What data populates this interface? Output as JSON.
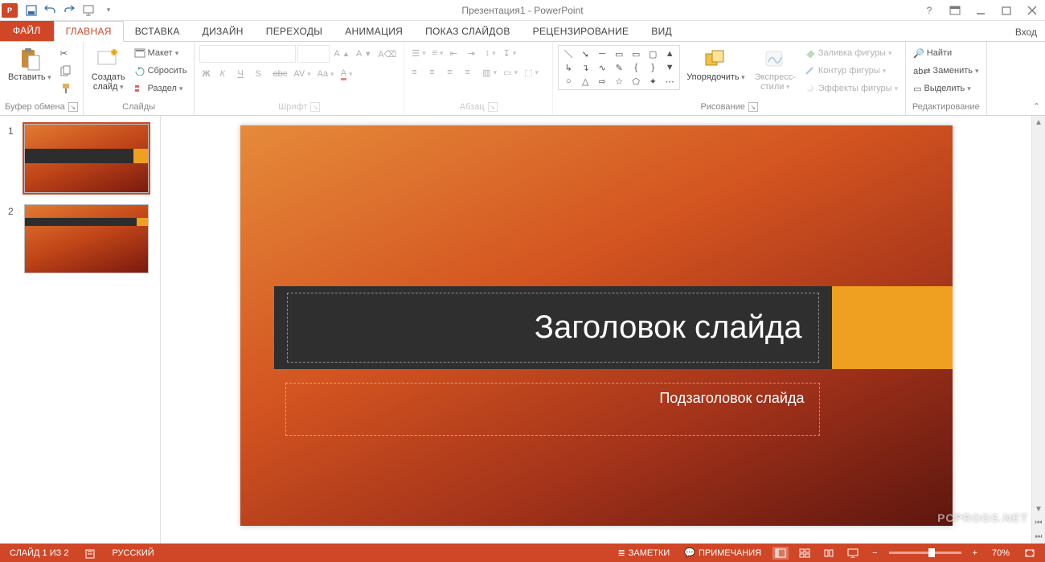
{
  "title": "Презентация1 - PowerPoint",
  "signin": "Вход",
  "tabs": {
    "file": "ФАЙЛ",
    "home": "ГЛАВНАЯ",
    "insert": "ВСТАВКА",
    "design": "ДИЗАЙН",
    "transitions": "ПЕРЕХОДЫ",
    "animations": "АНИМАЦИЯ",
    "slideshow": "ПОКАЗ СЛАЙДОВ",
    "review": "РЕЦЕНЗИРОВАНИЕ",
    "view": "ВИД"
  },
  "ribbon": {
    "clipboard": {
      "paste": "Вставить",
      "label": "Буфер обмена"
    },
    "slides": {
      "new_slide": "Создать\nслайд",
      "layout": "Макет",
      "reset": "Сбросить",
      "section": "Раздел",
      "label": "Слайды"
    },
    "font": {
      "label": "Шрифт",
      "bold": "Ж",
      "italic": "К",
      "underline": "Ч",
      "shadow": "S",
      "strike": "abc",
      "spacing": "AV",
      "case": "Aa",
      "color": "A"
    },
    "paragraph": {
      "label": "Абзац"
    },
    "drawing": {
      "arrange": "Упорядочить",
      "styles": "Экспресс-\nстили",
      "fill": "Заливка фигуры",
      "outline": "Контур фигуры",
      "effects": "Эффекты фигуры",
      "label": "Рисование"
    },
    "editing": {
      "find": "Найти",
      "replace": "Заменить",
      "select": "Выделить",
      "label": "Редактирование"
    }
  },
  "thumbs": {
    "n1": "1",
    "n2": "2"
  },
  "slide": {
    "title": "Заголовок слайда",
    "subtitle": "Подзаголовок слайда"
  },
  "status": {
    "slide_of": "СЛАЙД 1 ИЗ 2",
    "lang": "РУССКИЙ",
    "notes": "ЗАМЕТКИ",
    "comments": "ПРИМЕЧАНИЯ",
    "zoom": "70%"
  },
  "watermark": "PCPROGS.NET"
}
